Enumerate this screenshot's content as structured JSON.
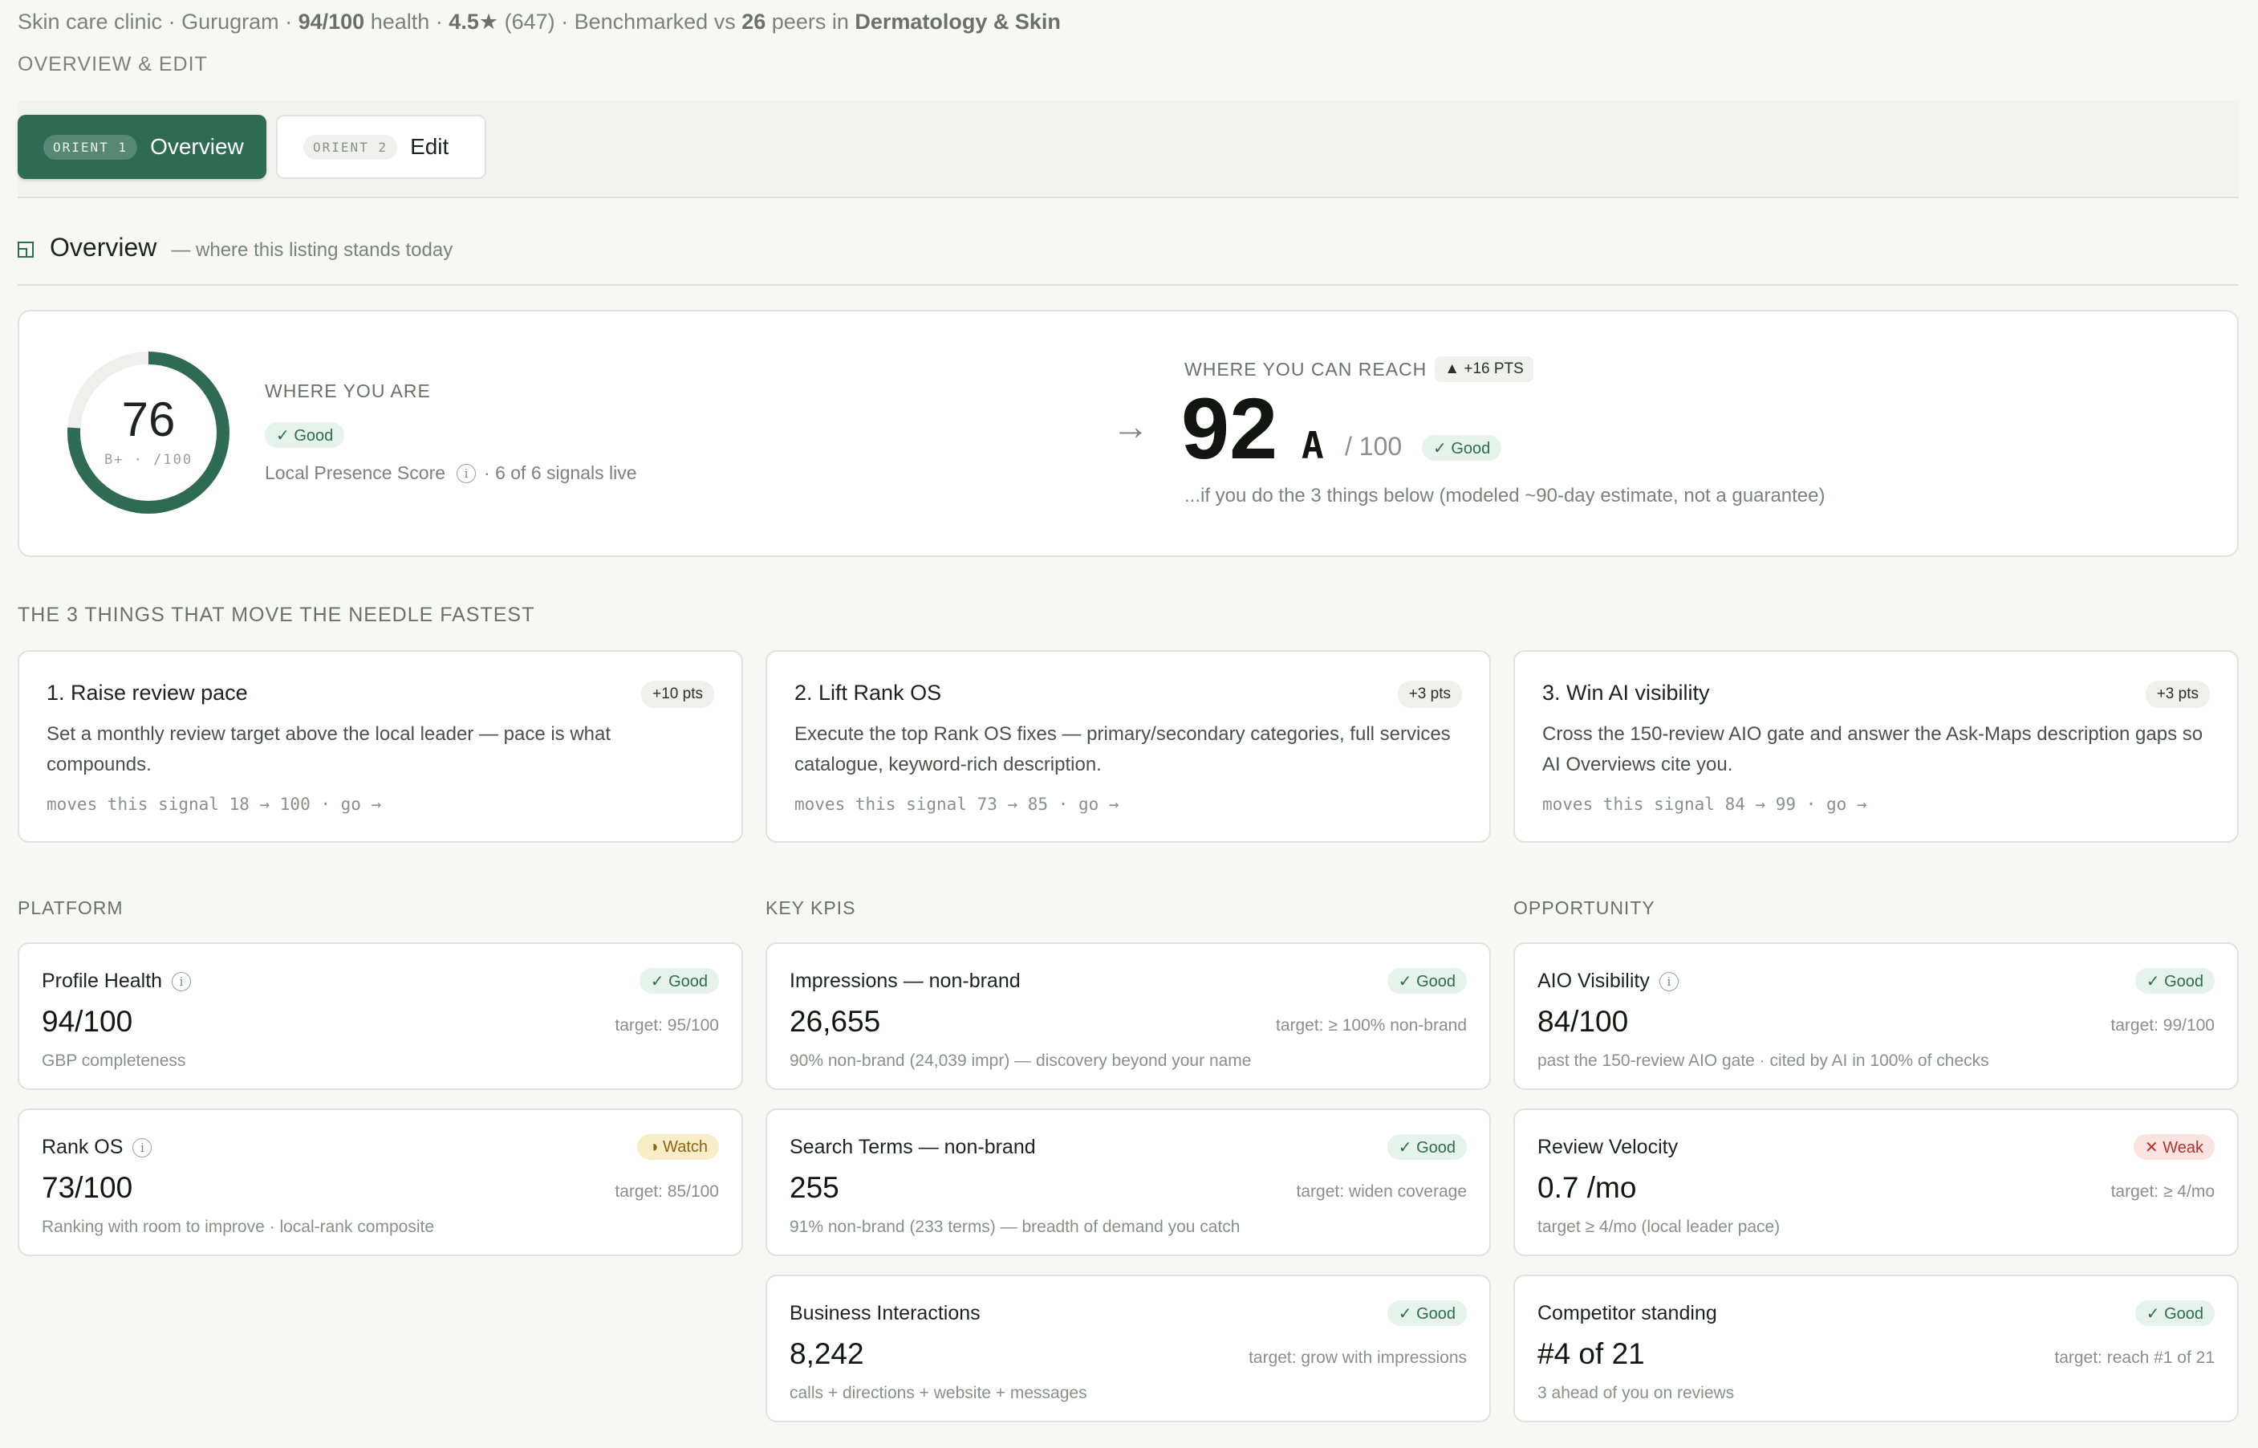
{
  "header": {
    "clinic_type": "Skin care clinic",
    "city": "Gurugram",
    "health_value": "94/100",
    "health_word": "health",
    "rating": "4.5",
    "review_count": "(647)",
    "bench_prefix": "Benchmarked vs",
    "peers": "26",
    "peers_in": "peers in",
    "category": "Dermatology & Skin",
    "overline": "OVERVIEW & EDIT"
  },
  "tabs": [
    {
      "pill": "ORIENT 1",
      "label": "Overview",
      "active": true
    },
    {
      "pill": "ORIENT 2",
      "label": "Edit",
      "active": false
    }
  ],
  "section": {
    "title": "Overview",
    "subtitle": "— where this listing stands today"
  },
  "current": {
    "score": "76",
    "score_value": 76,
    "grade_line": "B+ · /100",
    "label": "WHERE YOU ARE",
    "status": "✓ Good",
    "metric_name": "Local Presence Score",
    "info_glyph": "i",
    "signals": "· 6 of 6 signals live"
  },
  "target": {
    "label": "WHERE YOU CAN REACH",
    "delta": "▲ +16 PTS",
    "score": "92",
    "grade": "A",
    "out_of": "/ 100",
    "status": "✓ Good",
    "note": "...if you do the 3 things below (modeled ~90-day estimate, not a guarantee)"
  },
  "moves": {
    "title": "THE 3 THINGS THAT MOVE THE NEEDLE FASTEST",
    "items": [
      {
        "title": "1. Raise review pace",
        "pts": "+10 pts",
        "desc": "Set a monthly review target above the local leader — pace is what compounds.",
        "moves": "moves this signal 18 → 100 · go →"
      },
      {
        "title": "2. Lift Rank OS",
        "pts": "+3 pts",
        "desc": "Execute the top Rank OS fixes — primary/secondary categories, full services catalogue, keyword-rich description.",
        "moves": "moves this signal 73 → 85 · go →"
      },
      {
        "title": "3. Win AI visibility",
        "pts": "+3 pts",
        "desc": "Cross the 150-review AIO gate and answer the Ask-Maps description gaps so AI Overviews cite you.",
        "moves": "moves this signal 84 → 99 · go →"
      }
    ]
  },
  "columns": {
    "platform": "PLATFORM",
    "kpis": "KEY KPIS",
    "opportunity": "OPPORTUNITY"
  },
  "platform_cards": [
    {
      "title": "Profile Health",
      "status": "✓ Good",
      "value": "94/100",
      "target": "target: 95/100",
      "sub": "GBP completeness"
    },
    {
      "title": "Rank OS",
      "status": "◑ Watch",
      "value": "73/100",
      "target": "target: 85/100",
      "sub": "Ranking with room to improve · local-rank composite"
    }
  ],
  "kpi_cards": [
    {
      "title": "Impressions — non-brand",
      "status": "✓ Good",
      "value": "26,655",
      "target": "target: ≥ 100% non-brand",
      "sub": "90% non-brand (24,039 impr) — discovery beyond your name"
    },
    {
      "title": "Search Terms — non-brand",
      "status": "✓ Good",
      "value": "255",
      "target": "target: widen coverage",
      "sub": "91% non-brand (233 terms) — breadth of demand you catch"
    },
    {
      "title": "Business Interactions",
      "status": "✓ Good",
      "value": "8,242",
      "target": "target: grow with impressions",
      "sub": "calls + directions + website + messages"
    }
  ],
  "opportunity_cards": [
    {
      "title": "AIO Visibility",
      "status": "✓ Good",
      "value": "84/100",
      "target": "target: 99/100",
      "sub": "past the 150-review AIO gate · cited by AI in 100% of checks"
    },
    {
      "title": "Review Velocity",
      "status": "✕ Weak",
      "value": "0.7 /mo",
      "target": "target: ≥ 4/mo",
      "sub": "target ≥ 4/mo (local leader pace)"
    },
    {
      "title": "Competitor standing",
      "status": "✓ Good",
      "value": "#4 of 21",
      "target": "target: reach #1 of 21",
      "sub": "3 ahead of you on reviews"
    }
  ],
  "colors": {
    "brand": "#2f6a53",
    "good": "#2f6a53",
    "watch": "#8a6515",
    "weak": "#b4342c"
  },
  "icons": {
    "section": "overview-panel-icon",
    "star": "star-icon",
    "arrow": "arrow-right-icon",
    "info": "info-icon"
  }
}
